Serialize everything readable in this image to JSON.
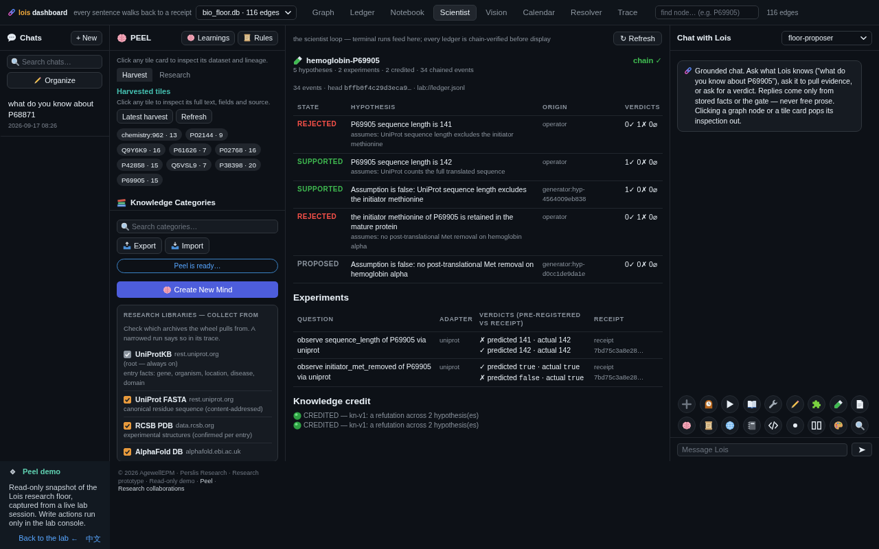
{
  "topbar": {
    "brand": {
      "accent": "lois",
      "name": "dashboard"
    },
    "tagline": "every sentence walks back to a receipt",
    "database": "bio_floor.db · 116 edges",
    "tabs": [
      {
        "label": "Graph",
        "selected": false
      },
      {
        "label": "Ledger",
        "selected": false
      },
      {
        "label": "Notebook",
        "selected": false
      },
      {
        "label": "Scientist",
        "selected": true
      },
      {
        "label": "Vision",
        "selected": false
      },
      {
        "label": "Calendar",
        "selected": false
      },
      {
        "label": "Resolver",
        "selected": false
      },
      {
        "label": "Trace",
        "selected": false
      }
    ],
    "search": {
      "placeholder": "find node… (e.g. P69905)"
    },
    "edge_count": "116 edges"
  },
  "chats": {
    "title": "Chats",
    "new_button": "+ New",
    "search": {
      "placeholder": "Search chats…"
    },
    "organize_button": "Organize",
    "items": [
      {
        "title": "what do you know about P68871",
        "time": "2026-09-17 08:26",
        "selected": false
      }
    ]
  },
  "peel": {
    "title": "PEEL",
    "buttons": [
      {
        "label": "Learnings",
        "kind": "brain"
      },
      {
        "label": "Rules",
        "kind": "scroll"
      }
    ],
    "intro": "Click any tile card to inspect its dataset and lineage.",
    "tabs": [
      {
        "label": "Harvest",
        "selected": true
      },
      {
        "label": "Research",
        "selected": false
      }
    ],
    "harvest": {
      "title": "Harvested tiles",
      "hint": "Click any tile to inspect its full text, fields and source.",
      "buttons": [
        "Latest harvest",
        "Refresh"
      ],
      "tiles": [
        "chemistry:962 · 13",
        "P02144 · 9",
        "Q9Y6K9 · 16",
        "P61626 · 7",
        "P02768 · 16",
        "P42858 · 15",
        "Q5VSL9 · 7",
        "P38398 · 20",
        "P69905 · 15"
      ]
    },
    "categories": {
      "title": "Knowledge Categories",
      "search": {
        "placeholder": "Search categories…"
      },
      "buttons": [
        {
          "label": "Export",
          "kind": "export"
        },
        {
          "label": "Import",
          "kind": "import"
        }
      ],
      "status": "Peel is ready…",
      "create_button": "Create New Mind"
    },
    "libraries": {
      "title": "RESEARCH LIBRARIES — COLLECT FROM",
      "hint": "Check which archives the wheel pulls from. A narrowed run says so in its trace.",
      "items": [
        {
          "name": "UniProtKB",
          "host": "rest.uniprot.org",
          "notes": [
            "(root — always on)",
            "entry facts: gene, organism, location, disease, domain"
          ],
          "checked": true,
          "disabled": true
        },
        {
          "name": "UniProt FASTA",
          "host": "rest.uniprot.org",
          "notes": [
            "canonical residue sequence (content-addressed)"
          ],
          "checked": true,
          "disabled": false
        },
        {
          "name": "RCSB PDB",
          "host": "data.rcsb.org",
          "notes": [
            "experimental structures (confirmed per entry)"
          ],
          "checked": true,
          "disabled": false
        },
        {
          "name": "AlphaFold DB",
          "host": "alphafold.ebi.ac.uk",
          "checked": true,
          "disabled": false
        }
      ]
    }
  },
  "scientist": {
    "intro": "the scientist loop — terminal runs feed here; every ledger is chain-verified before display",
    "refresh_button": "↻ Refresh",
    "project": {
      "name": "hemoglobin-P69905",
      "chain": "chain ✓"
    },
    "summary": "5 hypotheses · 2 experiments · 2 credited · 34 chained events",
    "ledger": [
      {
        "text": "34 events · head"
      },
      {
        "text": "bffb0f4c29d3eca9…",
        "kind": "mono"
      },
      {
        "text": "· lab://ledger.jsonl"
      }
    ],
    "hypotheses": {
      "columns": [
        "STATE",
        "HYPOTHESIS",
        "ORIGIN",
        "VERDICTS"
      ],
      "rows": [
        {
          "state": "REJECTED",
          "kind": "rejected",
          "text": "P69905 sequence length is 141",
          "assumes": "assumes: UniProt sequence length excludes the initiator methionine",
          "origin": "operator",
          "verdicts": "0✓ 1✗ 0⌀"
        },
        {
          "state": "SUPPORTED",
          "kind": "supported",
          "text": "P69905 sequence length is 142",
          "assumes": "assumes: UniProt counts the full translated sequence",
          "origin": "operator",
          "verdicts": "1✓ 0✗ 0⌀"
        },
        {
          "state": "SUPPORTED",
          "kind": "supported",
          "text": "Assumption is false: UniProt sequence length excludes the initiator methionine",
          "origin": "generator:hyp-4564009eb838",
          "verdicts": "1✓ 0✗ 0⌀"
        },
        {
          "state": "REJECTED",
          "kind": "rejected",
          "text": "the initiator methionine of P69905 is retained in the mature protein",
          "assumes": "assumes: no post-translational Met removal on hemoglobin alpha",
          "origin": "operator",
          "verdicts": "0✓ 1✗ 0⌀"
        },
        {
          "state": "PROPOSED",
          "kind": "proposed",
          "text": "Assumption is false: no post-translational Met removal on hemoglobin alpha",
          "origin": "generator:hyp-d0cc1de9da1e",
          "verdicts": "0✓ 0✗ 0⌀"
        }
      ]
    },
    "experiments": {
      "title": "Experiments",
      "columns": [
        "QUESTION",
        "ADAPTER",
        "VERDICTS (PRE-REGISTERED VS RECEIPT)",
        "RECEIPT"
      ],
      "rows": [
        {
          "question": "observe sequence_length of P69905 via uniprot",
          "adapter": "uniprot",
          "verdicts": [
            [
              {
                "text": "✗ predicted 141 · actual 142"
              }
            ],
            [
              {
                "text": "✓ predicted 142 · actual 142"
              }
            ]
          ],
          "receipt": "receipt 7bd75c3a8e28…"
        },
        {
          "question": "observe initiator_met_removed of P69905 via uniprot",
          "adapter": "uniprot",
          "verdicts": [
            [
              {
                "text": "✓ predicted"
              },
              {
                "text": "true",
                "kind": "mono"
              },
              {
                "text": "· actual"
              },
              {
                "text": "true",
                "kind": "mono"
              }
            ],
            [
              {
                "text": "✗ predicted"
              },
              {
                "text": "false",
                "kind": "mono"
              },
              {
                "text": "· actual"
              },
              {
                "text": "true",
                "kind": "mono"
              }
            ]
          ],
          "receipt": "receipt 7bd75c3a8e28…"
        }
      ]
    },
    "credit": {
      "title": "Knowledge credit",
      "items": [
        "CREDITED — kn-v1: a refutation across 2 hypothesis(es)",
        "CREDITED — kn-v1: a refutation across 2 hypothesis(es)"
      ]
    }
  },
  "chat": {
    "title": "Chat with Lois",
    "agent": "floor-proposer",
    "messages": [
      "Grounded chat. Ask what Lois knows (“what do you know about P69905”), ask it to pull evidence, or ask for a verdict. Replies come only from stored facts or the gate — never free prose. Clicking a graph node or a tile card pops its inspection out."
    ],
    "input": {
      "placeholder": "Message Lois"
    }
  },
  "demo": {
    "title": "Peel demo",
    "text": "Read-only snapshot of the Lois research floor, captured from a live lab session. Write actions run only in the lab console.",
    "links": [
      "Back to the lab ←",
      "中文"
    ]
  },
  "footer": {
    "parts": [
      {
        "text": "© 2026 AgewellEPM · Perslis Research · Research prototype · Read-only demo ·"
      },
      {
        "text": "Peel",
        "kind": "link"
      },
      {
        "text": "·"
      },
      {
        "text": "Research collaborations",
        "kind": "link"
      }
    ]
  }
}
